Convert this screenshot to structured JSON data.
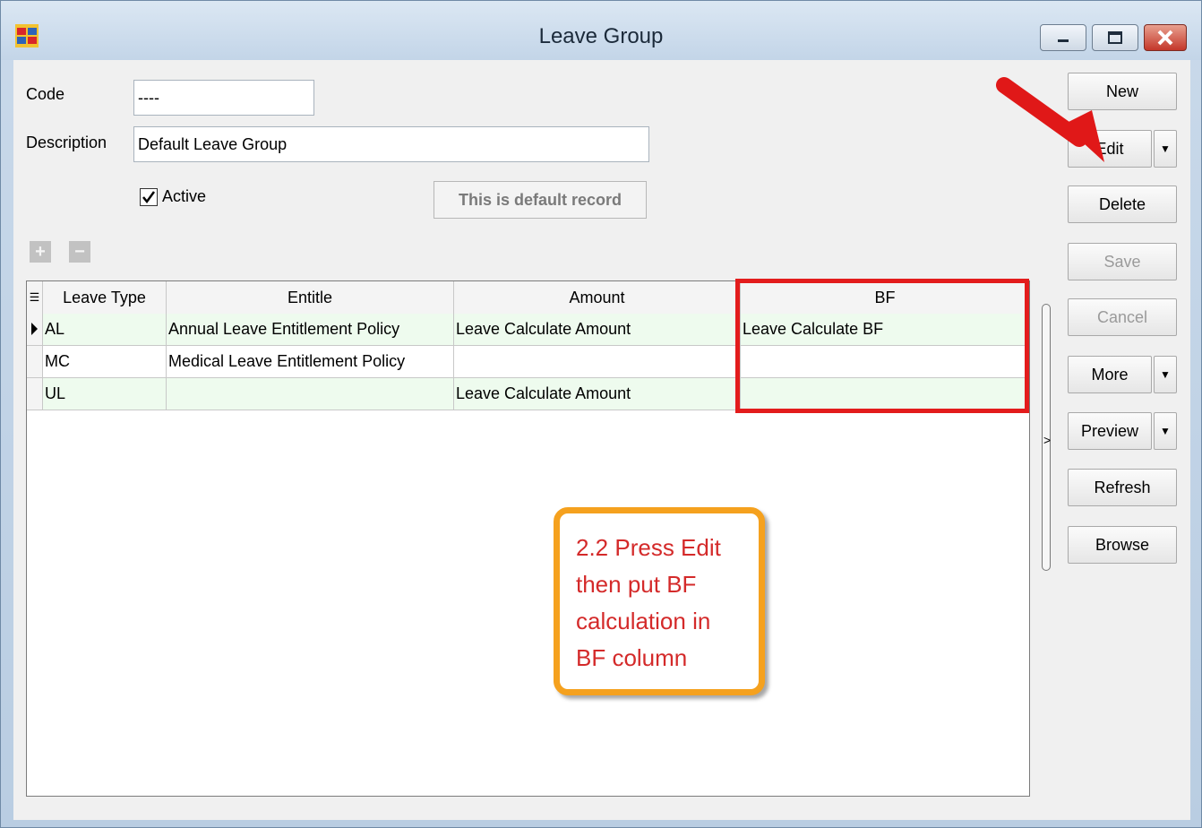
{
  "window": {
    "title": "Leave Group",
    "icon": "app-logo-icon",
    "controls": [
      "minimize-icon",
      "maximize-icon",
      "close-icon"
    ]
  },
  "form": {
    "code_label": "Code",
    "code_value": "----",
    "description_label": "Description",
    "description_value": "Default Leave Group",
    "active_label": "Active",
    "active_checked": true,
    "default_record_label": "This is default record"
  },
  "grid": {
    "columns": [
      "Leave Type",
      "Entitle",
      "Amount",
      "BF"
    ],
    "rows": [
      {
        "leave_type": "AL",
        "entitle": "Annual Leave Entitlement Policy",
        "amount": "Leave Calculate Amount",
        "bf": "Leave Calculate BF"
      },
      {
        "leave_type": "MC",
        "entitle": "Medical Leave Entitlement Policy",
        "amount": "",
        "bf": ""
      },
      {
        "leave_type": "UL",
        "entitle": "",
        "amount": "Leave Calculate Amount",
        "bf": ""
      }
    ]
  },
  "actions": {
    "new": "New",
    "edit": "Edit",
    "delete": "Delete",
    "save": "Save",
    "cancel": "Cancel",
    "more": "More",
    "preview": "Preview",
    "refresh": "Refresh",
    "browse": "Browse"
  },
  "annotation": {
    "line1": "2.2 Press Edit",
    "line2": "then put BF",
    "line3": "calculation in",
    "line4": "BF column"
  },
  "colors": {
    "highlight_box": "#e31c1c",
    "callout_border": "#f5a11e",
    "callout_text": "#d42a2a",
    "arrow": "#e01818",
    "row_alt": "#eefbee"
  }
}
